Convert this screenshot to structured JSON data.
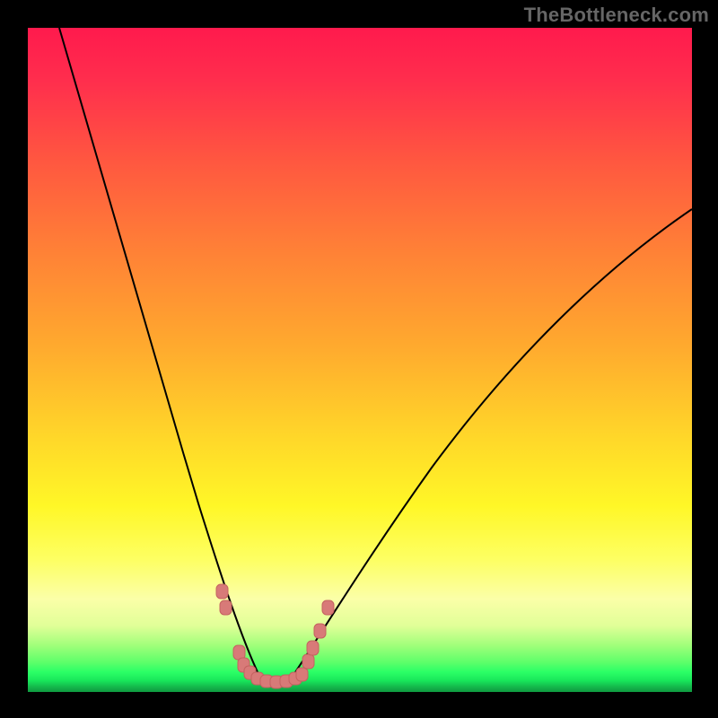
{
  "attribution": "TheBottleneck.com",
  "chart_data": {
    "type": "line",
    "title": "",
    "xlabel": "",
    "ylabel": "",
    "xlim": [
      0,
      100
    ],
    "ylim": [
      0,
      100
    ],
    "grid": false,
    "legend": false,
    "curve": {
      "description": "V-shaped bottleneck curve, two smooth arms meeting near x≈36",
      "x": [
        0,
        4,
        8,
        12,
        16,
        20,
        24,
        28,
        31,
        33,
        35,
        36,
        38,
        40,
        44,
        50,
        58,
        66,
        76,
        88,
        100
      ],
      "y": [
        100,
        92,
        84,
        76,
        68,
        58,
        48,
        36,
        24,
        14,
        6,
        3,
        5,
        9,
        16,
        25,
        36,
        46,
        56,
        66,
        73
      ]
    },
    "marker_region": {
      "description": "salmon-pink dotted markers near the trough",
      "x": [
        29.0,
        29.5,
        31.5,
        32.0,
        33.0,
        34.0,
        35.0,
        36.0,
        37.0,
        38.0,
        39.0,
        40.0,
        40.6,
        41.5,
        42.7
      ],
      "y": [
        14.5,
        12.0,
        5.0,
        3.2,
        2.3,
        1.9,
        1.8,
        1.8,
        1.9,
        2.2,
        2.7,
        5.0,
        7.0,
        9.5,
        13.0
      ]
    },
    "colors": {
      "gradient_top": "#ff1a4d",
      "gradient_mid": "#ffe627",
      "gradient_bottom": "#0f9a40",
      "curve_stroke": "#000000",
      "markers_fill": "#d87a78",
      "markers_stroke": "#c46260"
    }
  }
}
